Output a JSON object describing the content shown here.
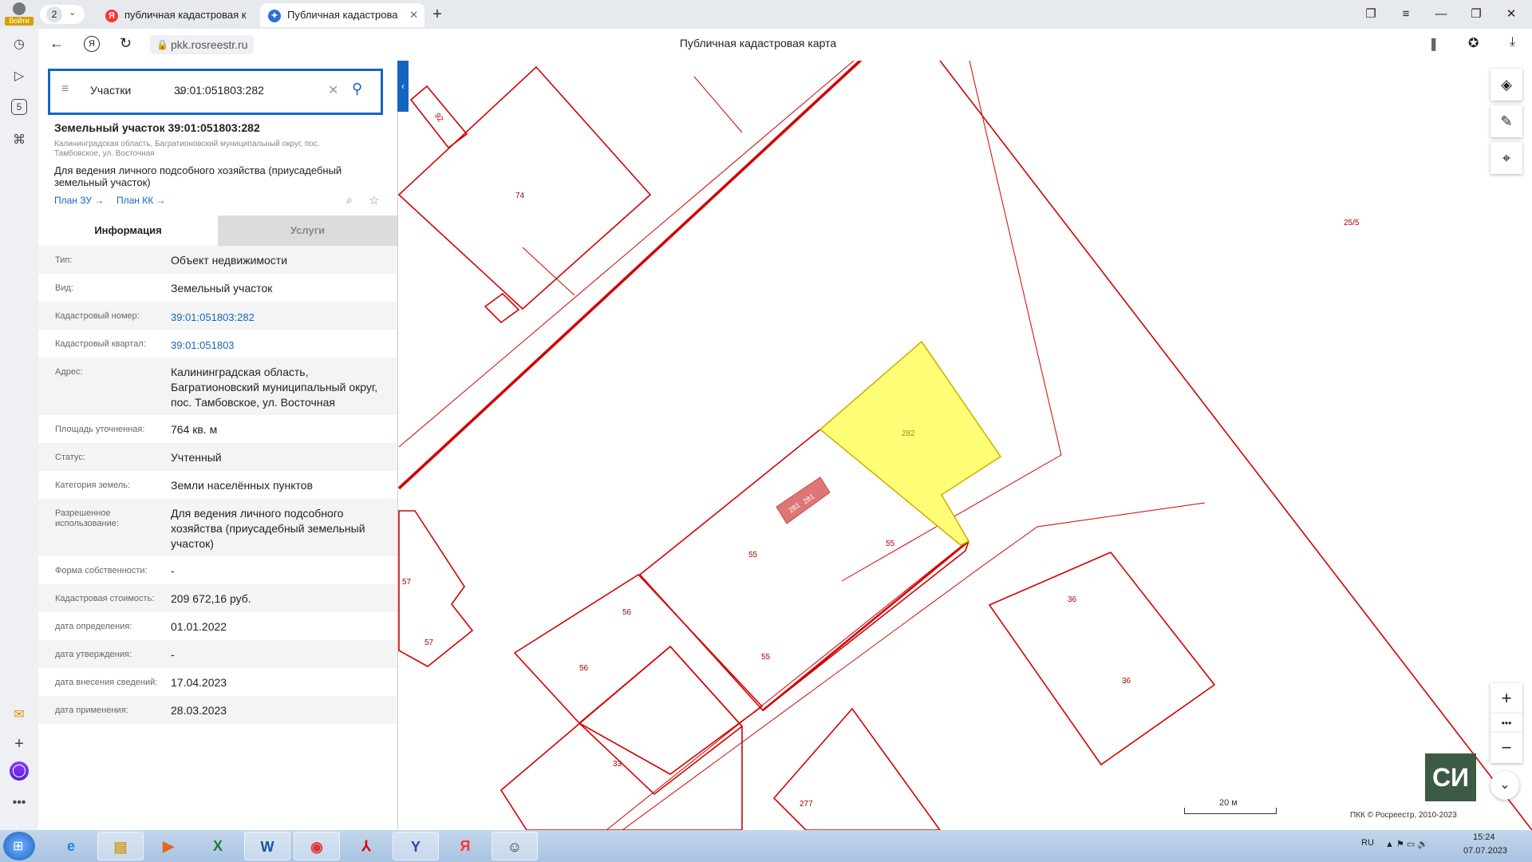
{
  "browser": {
    "profile_label": "Войти",
    "tab_counter": "2",
    "tabs": [
      {
        "title": "публичная кадастровая к"
      },
      {
        "title": "Публичная кадастрова"
      }
    ],
    "address": "pkk.rosreestr.ru",
    "page_title": "Публичная кадастровая карта"
  },
  "search": {
    "type_label": "Участки",
    "query": "39:01:051803:282"
  },
  "parcel": {
    "heading": "Земельный участок 39:01:051803:282",
    "address_line": "Калининградская область, Багратионовский муниципальный округ, пос. Тамбовское, ул. Восточная",
    "usage_line": "Для ведения личного подсобного хозяйства (приусадебный земельный участок)",
    "plan_zu": "План ЗУ →",
    "plan_kk": "План КК →"
  },
  "tabs": {
    "info": "Информация",
    "services": "Услуги"
  },
  "info_rows": [
    {
      "label": "Тип:",
      "value": "Объект недвижимости"
    },
    {
      "label": "Вид:",
      "value": "Земельный участок"
    },
    {
      "label": "Кадастровый номер:",
      "value": "39:01:051803:282"
    },
    {
      "label": "Кадастровый квартал:",
      "value": "39:01:051803"
    },
    {
      "label": "Адрес:",
      "value": "Калининградская область, Багратионовский муниципальный округ, пос. Тамбовское, ул. Восточная"
    },
    {
      "label": "Площадь уточненная:",
      "value": "764 кв. м"
    },
    {
      "label": "Статус:",
      "value": "Учтенный"
    },
    {
      "label": "Категория земель:",
      "value": "Земли населённых пунктов"
    },
    {
      "label": "Разрешенное использование:",
      "value": "Для ведения личного подсобного хозяйства (приусадебный земельный участок)"
    },
    {
      "label": "Форма собственности:",
      "value": "-"
    },
    {
      "label": "Кадастровая стоимость:",
      "value": "209 672,16 руб."
    },
    {
      "label": "дата определения:",
      "value": "01.01.2022"
    },
    {
      "label": "дата утверждения:",
      "value": "-"
    },
    {
      "label": "дата внесения сведений:",
      "value": "17.04.2023"
    },
    {
      "label": "дата применения:",
      "value": "28.03.2023"
    }
  ],
  "map": {
    "labels": [
      "92",
      "74",
      "25/5",
      "282",
      "281",
      "281",
      "55",
      "55",
      "55",
      "57",
      "57",
      "56",
      "56",
      "36",
      "36",
      "33",
      "277"
    ],
    "scale_label": "20 м",
    "copyright": "ПКК © Росреестр, 2010-2023"
  },
  "taskbar": {
    "lang": "RU",
    "time": "15:24",
    "date": "07.07.2023"
  },
  "colors": {
    "accent": "#1565c0",
    "parcel_line": "#d40000",
    "selected_fill": "#ffff77",
    "selected_stroke": "#d4b000",
    "building_fill": "#dd7777"
  }
}
